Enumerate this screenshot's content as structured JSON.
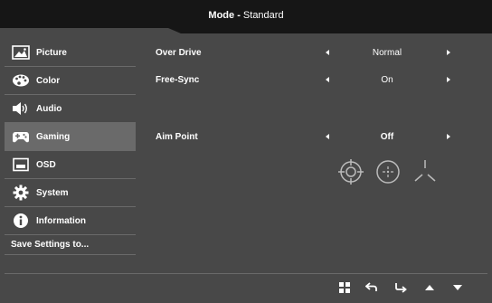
{
  "header": {
    "label": "Mode",
    "separator": " - ",
    "mode": "Standard"
  },
  "sidebar": {
    "items": [
      {
        "label": "Picture",
        "icon": "picture-icon"
      },
      {
        "label": "Color",
        "icon": "palette-icon"
      },
      {
        "label": "Audio",
        "icon": "speaker-icon"
      },
      {
        "label": "Gaming",
        "icon": "gamepad-icon",
        "active": true
      },
      {
        "label": "OSD",
        "icon": "osd-icon"
      },
      {
        "label": "System",
        "icon": "gear-icon"
      },
      {
        "label": "Information",
        "icon": "info-icon"
      }
    ],
    "save_label": "Save Settings to..."
  },
  "settings": [
    {
      "name": "Over Drive",
      "value": "Normal"
    },
    {
      "name": "Free-Sync",
      "value": "On"
    },
    {
      "name": "Aim Point",
      "value": "Off"
    }
  ],
  "aim_point_styles": [
    "crosshair-circle-icon",
    "crosshair-dotted-circle-icon",
    "crosshair-tri-icon"
  ],
  "footer": {
    "buttons": [
      "menu-grid-icon",
      "back-icon",
      "enter-icon",
      "up-icon",
      "down-icon"
    ]
  },
  "colors": {
    "background": "#484848",
    "header": "#161616",
    "active": "#6a6a6a",
    "text": "#ffffff"
  }
}
